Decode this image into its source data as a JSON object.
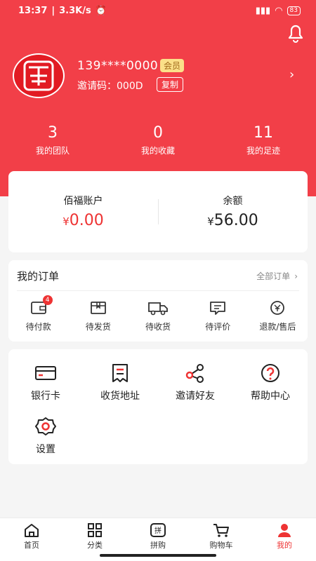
{
  "status_bar": {
    "time": "13:37",
    "speed": "3.3K/s",
    "battery": "83"
  },
  "profile": {
    "phone": "139****0000",
    "vip_label": "会员",
    "invite_label": "邀请码：",
    "invite_code": "000D",
    "copy_label": "复制"
  },
  "stats": [
    {
      "value": "3",
      "label": "我的团队"
    },
    {
      "value": "0",
      "label": "我的收藏"
    },
    {
      "value": "11",
      "label": "我的足迹"
    }
  ],
  "account": {
    "left": {
      "title": "佰福账户",
      "currency": "¥",
      "amount": "0.00",
      "color": "#e33"
    },
    "right": {
      "title": "余额",
      "currency": "¥",
      "amount": "56.00",
      "color": "#222"
    }
  },
  "orders": {
    "title": "我的订单",
    "all_label": "全部订单",
    "items": [
      {
        "label": "待付款",
        "icon": "wallet-icon",
        "badge": "4"
      },
      {
        "label": "待发货",
        "icon": "package-icon"
      },
      {
        "label": "待收货",
        "icon": "truck-icon"
      },
      {
        "label": "待评价",
        "icon": "comment-icon"
      },
      {
        "label": "退款/售后",
        "icon": "refund-icon"
      }
    ]
  },
  "services": [
    {
      "label": "银行卡",
      "icon": "bank-card-icon"
    },
    {
      "label": "收货地址",
      "icon": "address-icon"
    },
    {
      "label": "邀请好友",
      "icon": "share-icon"
    },
    {
      "label": "帮助中心",
      "icon": "help-icon"
    },
    {
      "label": "设置",
      "icon": "settings-icon"
    }
  ],
  "tabbar": [
    {
      "label": "首页",
      "icon": "home-icon"
    },
    {
      "label": "分类",
      "icon": "grid-icon"
    },
    {
      "label": "拼购",
      "icon": "group-buy-icon",
      "icon_text": "拼"
    },
    {
      "label": "购物车",
      "icon": "cart-icon"
    },
    {
      "label": "我的",
      "icon": "user-icon",
      "active": true
    }
  ],
  "colors": {
    "brand_red": "#f23f48",
    "accent_red": "#e33",
    "vip_gold": "#fbe089"
  }
}
